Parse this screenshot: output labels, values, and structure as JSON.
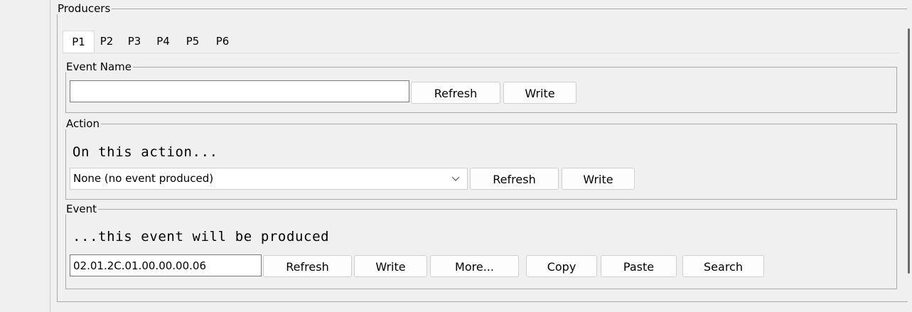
{
  "producers": {
    "title": "Producers",
    "tabs": [
      {
        "label": "P1",
        "selected": true
      },
      {
        "label": "P2",
        "selected": false
      },
      {
        "label": "P3",
        "selected": false
      },
      {
        "label": "P4",
        "selected": false
      },
      {
        "label": "P5",
        "selected": false
      },
      {
        "label": "P6",
        "selected": false
      }
    ]
  },
  "event_name": {
    "title": "Event Name",
    "value": "",
    "refresh_label": "Refresh",
    "write_label": "Write"
  },
  "action": {
    "title": "Action",
    "prompt": "On this action...",
    "selected_option": "None (no event produced)",
    "dropdown_icon": "chevron-down-icon",
    "refresh_label": "Refresh",
    "write_label": "Write"
  },
  "event": {
    "title": "Event",
    "prompt": "...this event will be produced",
    "value": "02.01.2C.01.00.00.00.06",
    "refresh_label": "Refresh",
    "write_label": "Write",
    "more_label": "More...",
    "copy_label": "Copy",
    "paste_label": "Paste",
    "search_label": "Search"
  }
}
